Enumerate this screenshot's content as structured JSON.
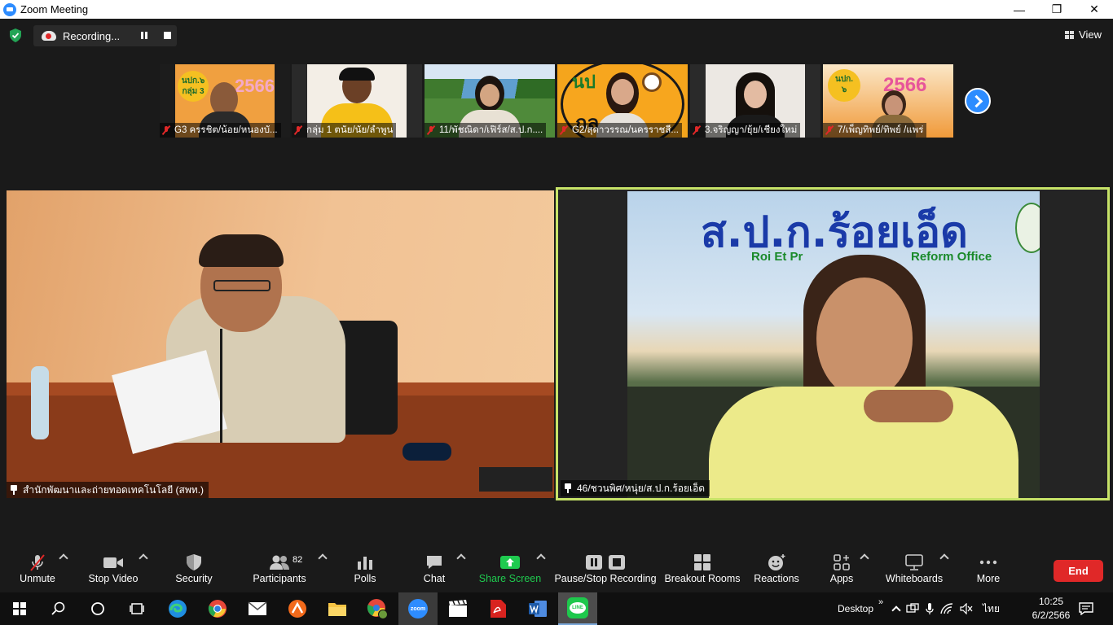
{
  "window": {
    "title": "Zoom Meeting",
    "controls": [
      "—",
      "❐",
      "✕"
    ]
  },
  "topbar": {
    "recording_label": "Recording...",
    "view_label": "View"
  },
  "thumbnails": [
    {
      "name": "G3 ครรชิต/น้อย/หนองบั..."
    },
    {
      "name": "กลุ่ม 1 ตนัย/นัย/ลำพูน"
    },
    {
      "name": "11/พัชณิดา/เฟิร์ส/ส.ป.ก...."
    },
    {
      "name": "G2/สุดาวรรณ/นครราชสี..."
    },
    {
      "name": "3.จริญญา/ยุ้ย/เชียงใหม่"
    },
    {
      "name": "7/เพ็ญทิพย์/ทิพย์ /แพร่"
    }
  ],
  "thumb_overlay": {
    "t1_badge": "นปก.๖",
    "t1_sub": "กลุ่ม 3",
    "t1_year": "2566",
    "t4_badge": "นป",
    "t4_sub": "กล",
    "t6_badge": "นปก.",
    "t6_num": "๖",
    "t6_year": "2566"
  },
  "main_left": {
    "name": "สำนักพัฒนาและถ่ายทอดเทคโนโลยี (สพท.)"
  },
  "main_right": {
    "name": "46/ชวนพิศ/หนุ่ย/ส.ป.ก.ร้อยเอ็ด",
    "banner_thai": "ส.ป.ก.ร้อยเอ็ด",
    "banner_en_left": "Roi Et Pr",
    "banner_en_right": "Reform Office"
  },
  "toolbar": {
    "unmute": "Unmute",
    "stop_video": "Stop Video",
    "security": "Security",
    "participants": "Participants",
    "participants_count": "82",
    "polls": "Polls",
    "chat": "Chat",
    "share_screen": "Share Screen",
    "pause_stop_recording": "Pause/Stop Recording",
    "breakout_rooms": "Breakout Rooms",
    "reactions": "Reactions",
    "apps": "Apps",
    "whiteboards": "Whiteboards",
    "more": "More",
    "end": "End"
  },
  "taskbar": {
    "desktop_label": "Desktop",
    "language": "ไทย",
    "time": "10:25",
    "date": "6/2/2566",
    "zoom_label": "zoom",
    "line_label": "LINE"
  },
  "colors": {
    "accent_blue": "#2d8cff",
    "end_red": "#e02828",
    "active_speaker": "#c7e368",
    "share_green": "#1fca4f"
  }
}
